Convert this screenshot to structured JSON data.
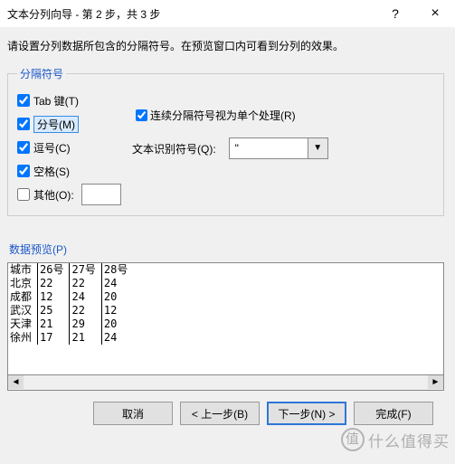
{
  "dialog": {
    "title": "文本分列向导 - 第 2 步，共 3 步",
    "help_icon": "?",
    "close_icon": "×",
    "instruction": "请设置分列数据所包含的分隔符号。在预览窗口内可看到分列的效果。"
  },
  "delimiters": {
    "legend": "分隔符号",
    "tab": {
      "label": "Tab 键(T)",
      "checked": true
    },
    "semicolon": {
      "label": "分号(M)",
      "checked": true,
      "highlight": true
    },
    "comma": {
      "label": "逗号(C)",
      "checked": true
    },
    "space": {
      "label": "空格(S)",
      "checked": true
    },
    "other": {
      "label": "其他(O):",
      "checked": false,
      "value": ""
    }
  },
  "options": {
    "treat_consecutive": {
      "label": "连续分隔符号视为单个处理(R)",
      "checked": true
    },
    "text_qualifier_label": "文本识别符号(Q):",
    "text_qualifier_value": "\""
  },
  "preview": {
    "label": "数据预览(P)",
    "headers": [
      "城市",
      "26号",
      "27号",
      "28号"
    ],
    "rows": [
      [
        "北京",
        "22",
        "22",
        "24"
      ],
      [
        "成都",
        "12",
        "24",
        "20"
      ],
      [
        "武汉",
        "25",
        "22",
        "12"
      ],
      [
        "天津",
        "21",
        "29",
        "20"
      ],
      [
        "徐州",
        "17",
        "21",
        "24"
      ]
    ]
  },
  "buttons": {
    "cancel": "取消",
    "back": "< 上一步(B)",
    "next": "下一步(N) >",
    "finish": "完成(F)"
  },
  "watermark": "什么值得买"
}
